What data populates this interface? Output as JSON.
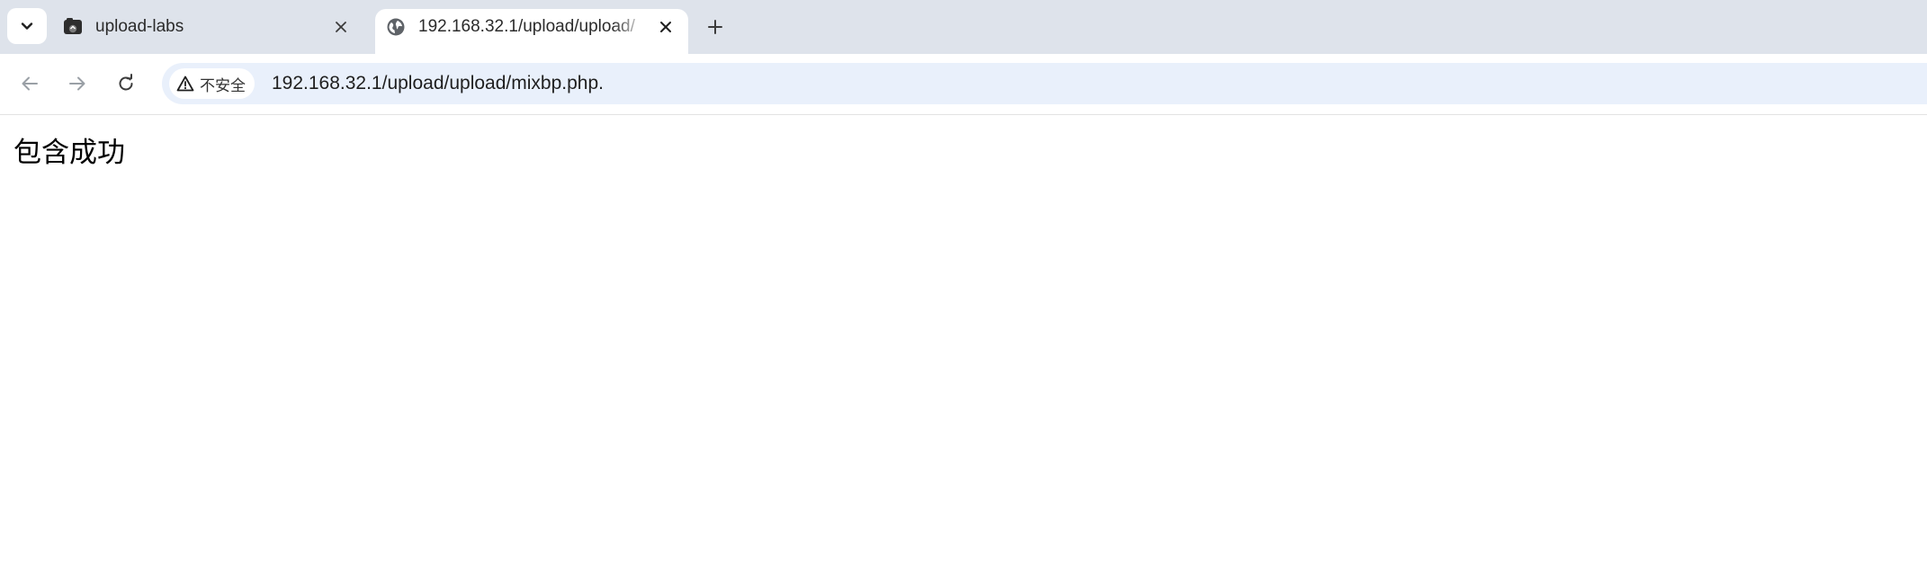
{
  "tabs": [
    {
      "title": "upload-labs",
      "active": false,
      "favicon": "site-favicon-icon"
    },
    {
      "title": "192.168.32.1/upload/upload/",
      "active": true,
      "favicon": "globe-icon"
    }
  ],
  "toolbar": {
    "security_label": "不安全",
    "url": "192.168.32.1/upload/upload/mixbp.php."
  },
  "page": {
    "body_text": "包含成功"
  },
  "icons": {
    "tab_search": "chevron-down-icon",
    "close": "close-icon",
    "new_tab": "plus-icon",
    "back": "back-arrow-icon",
    "forward": "forward-arrow-icon",
    "reload": "reload-icon",
    "warning": "warning-icon"
  },
  "colors": {
    "tabstrip_bg": "#dee3eb",
    "omnibox_bg": "#e9f0fb",
    "page_bg": "#ffffff"
  }
}
